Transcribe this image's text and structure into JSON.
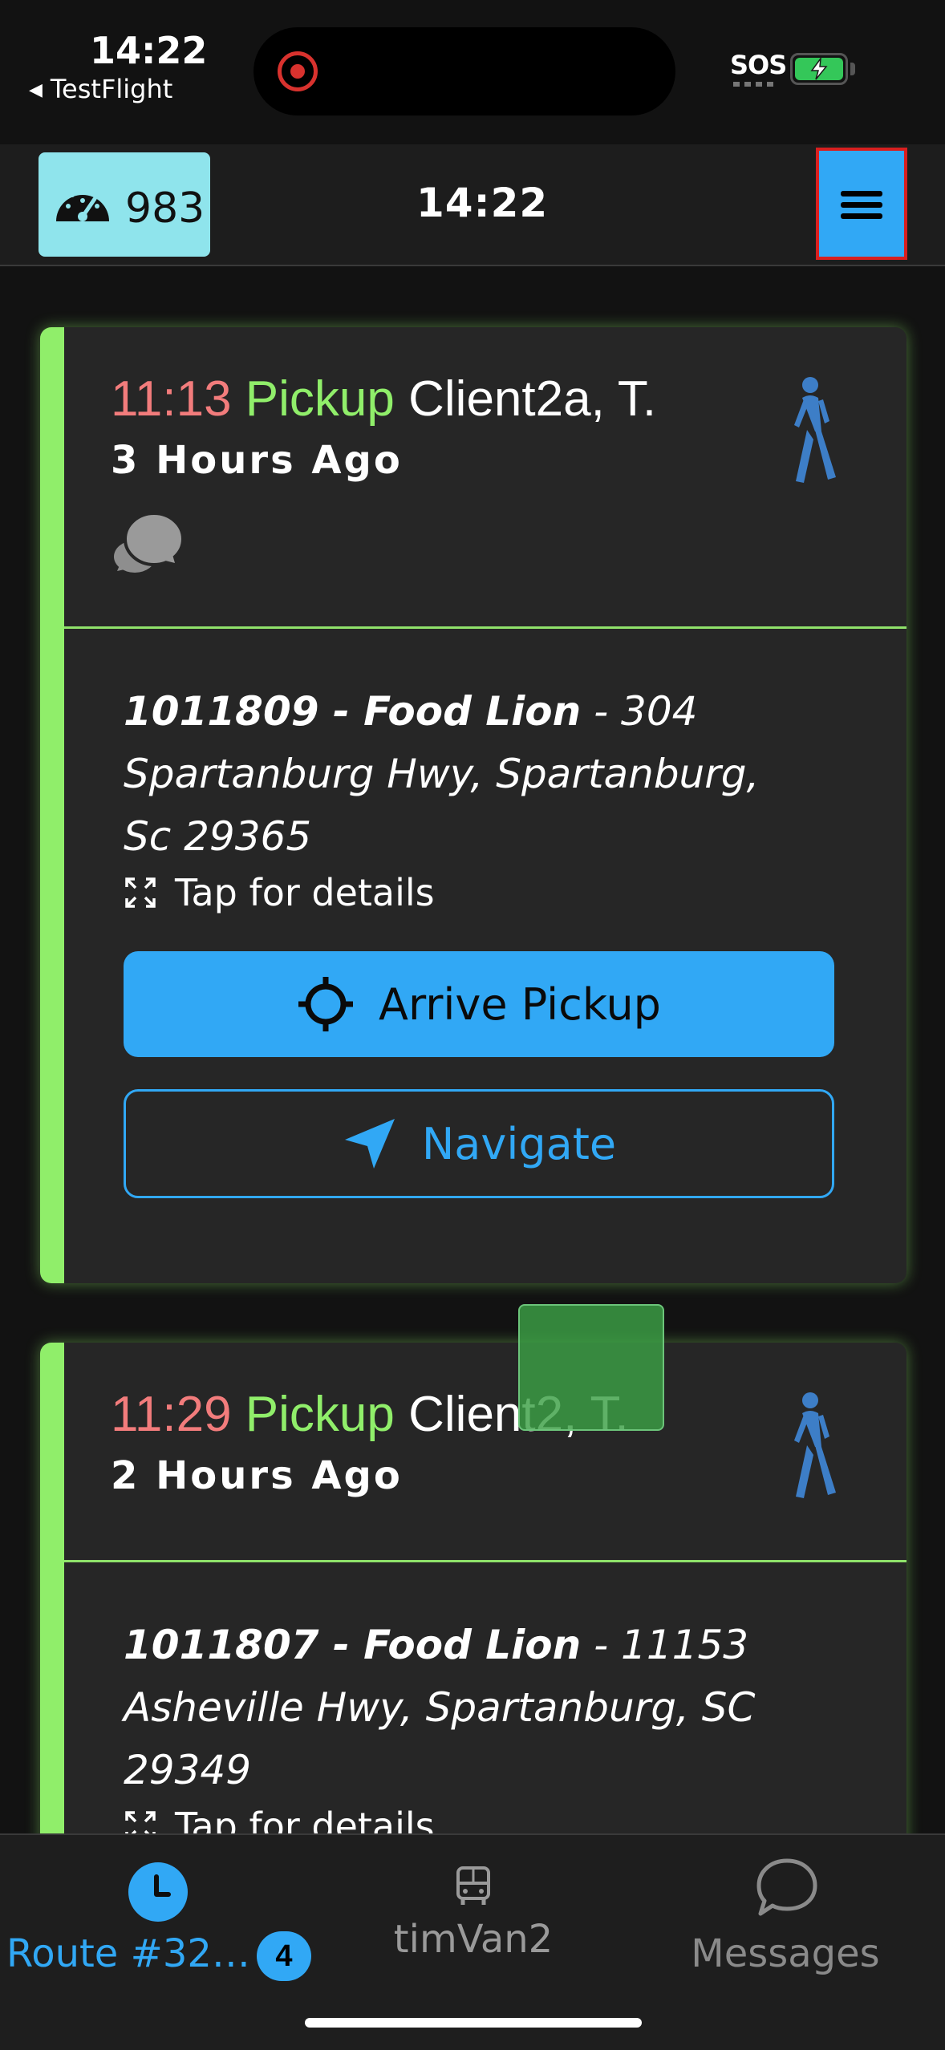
{
  "status_bar": {
    "time": "14:22",
    "back_app": "TestFlight",
    "sos": "SOS"
  },
  "header": {
    "speed_value": "983",
    "time": "14:22"
  },
  "stops": [
    {
      "time": "11:13",
      "type": "Pickup",
      "client": "Client2a, T.",
      "ago": "3 Hours Ago",
      "location_id": "1011809 - Food Lion",
      "address": " - 304 Spartanburg Hwy, Spartanburg, Sc 29365",
      "details_label": "Tap for details",
      "arrive_label": "Arrive Pickup",
      "navigate_label": "Navigate"
    },
    {
      "time": "11:29",
      "type": "Pickup",
      "client": "Client2, T.",
      "ago": "2 Hours Ago",
      "location_id": "1011807 - Food Lion",
      "address": " - 11153 Asheville Hwy, Spartanburg, SC 29349",
      "details_label": "Tap for details"
    }
  ],
  "tabs": {
    "route_label": "Route #32…",
    "route_badge": "4",
    "van_label": "timVan2",
    "messages_label": "Messages"
  },
  "colors": {
    "accent_blue": "#31a8f5",
    "card_border_green": "#90ee6a",
    "time_red": "#f27c7c",
    "speed_pill": "#8fe4ec"
  },
  "icons": {
    "speedometer": "speedometer-icon",
    "menu": "hamburger-menu-icon",
    "walker": "walking-person-icon",
    "chat": "chat-bubbles-icon",
    "expand": "expand-icon",
    "crosshair": "crosshair-icon",
    "navigate": "navigation-arrow-icon",
    "clock": "clock-icon",
    "bus": "bus-icon",
    "messages": "message-bubble-icon"
  }
}
